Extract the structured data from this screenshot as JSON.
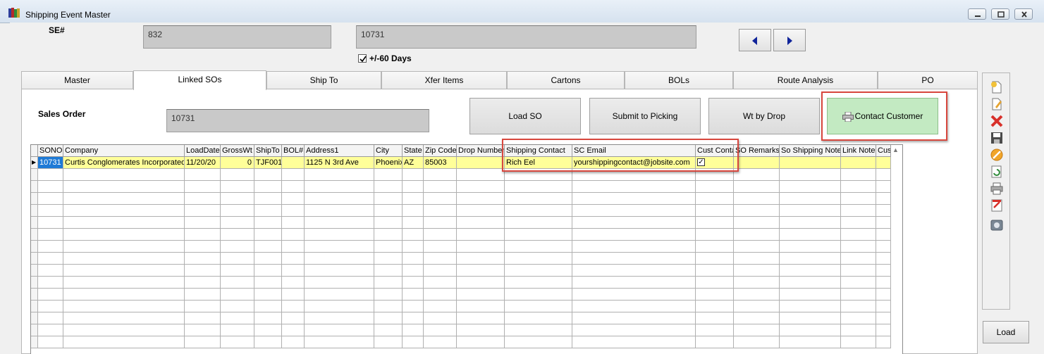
{
  "window": {
    "title": "Shipping Event Master",
    "icon": "app-books-icon"
  },
  "header": {
    "se_label": "SE#",
    "se_value": "832",
    "so_value": "10731",
    "days_checkbox": {
      "checked": true,
      "label": "+/-60 Days"
    }
  },
  "tabs": [
    {
      "label": "Master",
      "active": false
    },
    {
      "label": "Linked SOs",
      "active": true
    },
    {
      "label": "Ship To",
      "active": false
    },
    {
      "label": "Xfer Items",
      "active": false
    },
    {
      "label": "Cartons",
      "active": false
    },
    {
      "label": "BOLs",
      "active": false
    },
    {
      "label": "Route Analysis",
      "active": false
    },
    {
      "label": "PO",
      "active": false
    }
  ],
  "linked_sos": {
    "sales_order_label": "Sales Order",
    "sales_order_value": "10731",
    "buttons": {
      "load_so": "Load SO",
      "submit_picking": "Submit to Picking",
      "wt_by_drop": "Wt by Drop",
      "contact_customer": "Contact Customer"
    },
    "highlight_color": "#d8473e",
    "grid": {
      "columns": [
        "SONO",
        "Company",
        "LoadDate",
        "GrossWt",
        "ShipTo",
        "BOL#",
        "Address1",
        "City",
        "State",
        "Zip Code",
        "Drop Number",
        "Shipping Contact",
        "SC Email",
        "Cust Conta",
        "SO Remarks",
        "So Shipping Note",
        "Link Note",
        "Cus"
      ],
      "rows": [
        {
          "SONO": "10731",
          "Company": "Curtis Conglomerates Incorporated",
          "LoadDate": "11/20/20",
          "GrossWt": "0",
          "ShipTo": "TJF001",
          "BOL#": "",
          "Address1": "1125 N 3rd Ave",
          "City": "Phoenix",
          "State": "AZ",
          "Zip Code": "85003",
          "Drop Number": "",
          "Shipping Contact": "Rich Eel",
          "SC Email": "yourshippingcontact@jobsite.com",
          "Cust Conta": true,
          "SO Remarks": "",
          "So Shipping Note": "",
          "Link Note": "",
          "Cus": ""
        }
      ]
    }
  },
  "sidebar": {
    "tools": [
      "new-document-icon",
      "edit-document-icon",
      "delete-icon",
      "save-icon",
      "cancel-icon",
      "refresh-icon",
      "print-icon",
      "report-icon",
      "camera-icon"
    ],
    "load_label": "Load"
  },
  "colors": {
    "row_highlight": "#ffff99",
    "selected_cell": "#1e7ad6",
    "contact_button": "#c3eac2"
  }
}
